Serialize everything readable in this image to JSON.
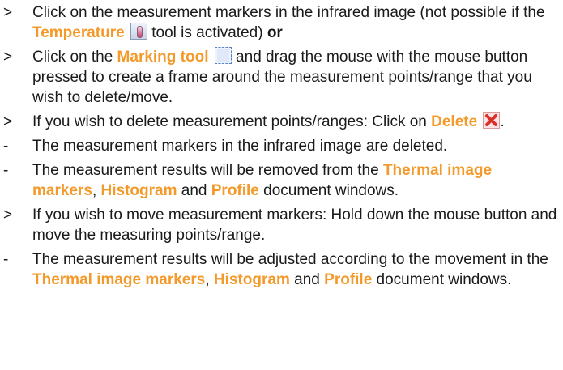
{
  "items": [
    {
      "marker": ">",
      "parts": [
        "Click on the measurement markers in the infrared image (not possible if the ",
        "Temperature",
        " tool is activated) ",
        "or"
      ]
    },
    {
      "marker": ">",
      "parts": [
        "Click on the ",
        "Marking tool",
        " and drag the mouse with the mouse button pressed to create a frame around the measurement points/range that you wish to delete/move."
      ]
    },
    {
      "marker": ">",
      "parts": [
        "If you wish to delete measurement points/ranges: Click on ",
        "Delete",
        "."
      ]
    },
    {
      "marker": "-",
      "parts": [
        "The measurement markers in the infrared image are deleted."
      ]
    },
    {
      "marker": "-",
      "parts": [
        "The measurement results will be removed from the ",
        "Thermal image markers",
        ", ",
        "Histogram",
        " and ",
        "Profile",
        " document windows."
      ]
    },
    {
      "marker": ">",
      "parts": [
        "If you wish to move measurement markers: Hold down the mouse button and move the measuring points/range."
      ]
    },
    {
      "marker": "-",
      "parts": [
        "The measurement results will be adjusted according to the movement in the ",
        "Thermal image markers",
        ", ",
        "Histogram",
        " and ",
        "Profile",
        " document windows."
      ]
    }
  ],
  "icons": {
    "temperature": "thermometer-icon",
    "marking": "marquee-select-icon",
    "delete": "red-x-delete-icon"
  },
  "colors": {
    "keyword": "#f39a2b",
    "text": "#1a1a1a"
  }
}
